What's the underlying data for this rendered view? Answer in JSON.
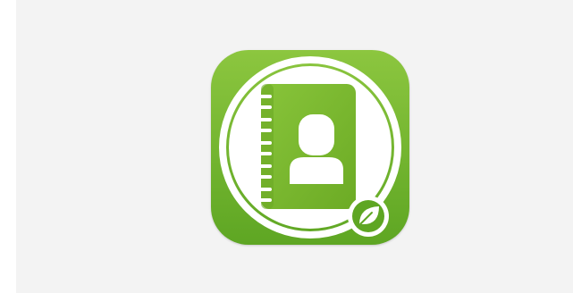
{
  "icon": {
    "name": "contacts-address-book-app-icon",
    "glyph": "address-book-with-person-and-leaf-badge"
  },
  "colors": {
    "page_background": "#f3f3f3",
    "outer_background": "#ffffff",
    "icon_gradient_top": "#8cc63f",
    "icon_gradient_bottom": "#5ea623",
    "book_green": "#79b92e",
    "book_spine": "#6aa924",
    "white": "#ffffff"
  }
}
